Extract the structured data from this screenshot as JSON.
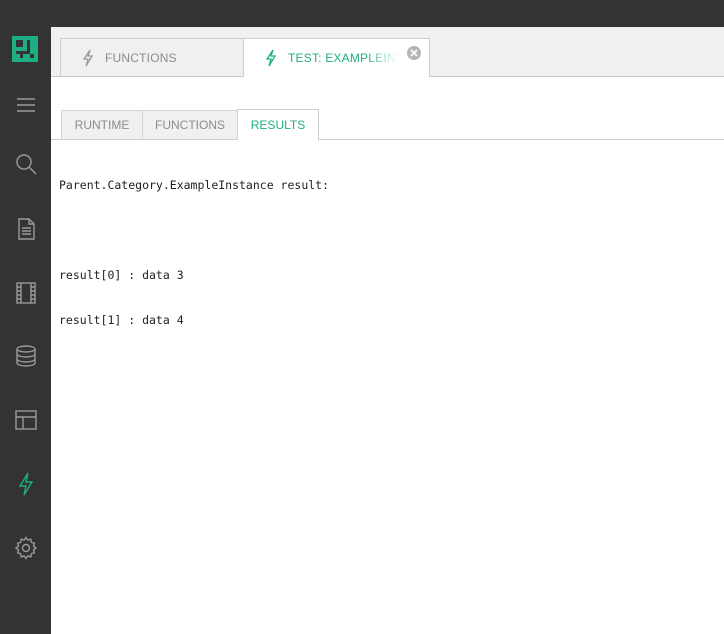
{
  "sidebar": {
    "logo": "app-logo",
    "items": [
      {
        "icon": "menu-icon",
        "active": false
      },
      {
        "icon": "search-icon",
        "active": false
      },
      {
        "icon": "document-icon",
        "active": false
      },
      {
        "icon": "film-icon",
        "active": false
      },
      {
        "icon": "database-icon",
        "active": false
      },
      {
        "icon": "layout-icon",
        "active": false
      },
      {
        "icon": "lightning-icon",
        "active": true
      },
      {
        "icon": "gear-icon",
        "active": false
      }
    ]
  },
  "tabs": [
    {
      "label": "FUNCTIONS",
      "icon": "lightning-icon"
    },
    {
      "label": "TEST: EXAMPLEINSTANCE",
      "icon": "lightning-icon",
      "active": true
    }
  ],
  "subtabs": [
    {
      "label": "RUNTIME"
    },
    {
      "label": "FUNCTIONS"
    },
    {
      "label": "RESULTS",
      "active": true
    }
  ],
  "output": {
    "header": "Parent.Category.ExampleInstance result:",
    "lines": [
      "result[0] : data 3",
      "result[1] : data 4"
    ]
  },
  "colors": {
    "accent": "#1fae84",
    "sidebar": "#333333",
    "tabbar": "#f0f0f0"
  }
}
